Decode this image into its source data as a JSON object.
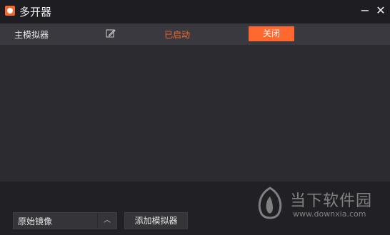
{
  "window": {
    "title": "多开器",
    "minimize_glyph": "−",
    "close_glyph": "✕"
  },
  "emulator_list": [
    {
      "name": "主模拟器",
      "edit_icon": "edit-icon",
      "status": "已启动",
      "action_label": "关闭"
    }
  ],
  "footer": {
    "mirror_select_value": "原始镜像",
    "add_button_label": "添加模拟器"
  },
  "watermark": {
    "name": "当下软件园",
    "url": "www.downxia.com"
  },
  "colors": {
    "accent": "#ff6930",
    "status_running": "#f26a2e",
    "titlebar": "#1e1e22",
    "row_bg": "#39393f",
    "body_bg": "#2b2b30"
  }
}
